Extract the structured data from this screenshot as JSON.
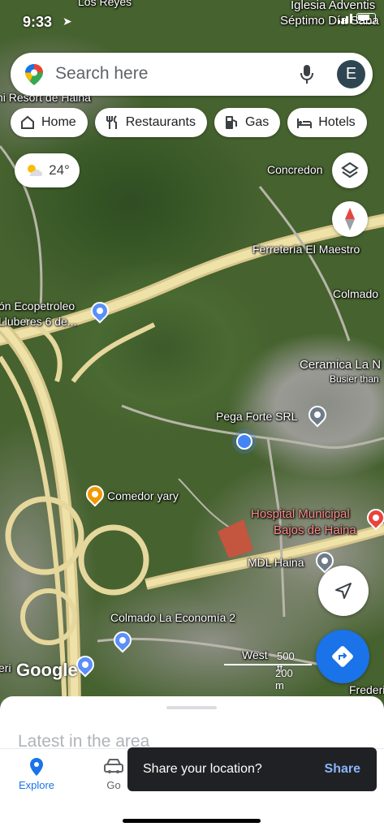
{
  "status_bar": {
    "time": "9:33"
  },
  "search": {
    "placeholder": "Search here",
    "avatar_letter": "E"
  },
  "chips": [
    {
      "label": "Home",
      "icon": "home-icon"
    },
    {
      "label": "Restaurants",
      "icon": "restaurant-icon"
    },
    {
      "label": "Gas",
      "icon": "gas-station-icon"
    },
    {
      "label": "Hotels",
      "icon": "hotel-icon"
    }
  ],
  "weather": {
    "temp": "24°",
    "icon": "partly-cloudy-icon"
  },
  "map_labels": {
    "top_right_1": "Iglesia Adventis",
    "top_right_2": "Séptimo Día Saba",
    "top_left": "Los Reyes",
    "resort": "ni Resort de Haina",
    "concredon": "Concredon",
    "ferreteria": "Ferretería El Maestro",
    "colmado_right": "Colmado",
    "ecopetroleo_1": "ón Ecopetroleo",
    "ecopetroleo_2": "Lluberes 6 de...",
    "ceramica": "Ceramica La N",
    "busier": "Busier than",
    "pega_forte": "Pega Forte SRL",
    "comedor": "Comedor yary",
    "hospital_1": "Hospital Municipal",
    "hospital_2": "Bajos de Haina",
    "mdl": "MDL Haina",
    "colmado_economia": "Colmado La Economía 2",
    "west": "West",
    "left_edge": "eri",
    "right_edge": "Frederic"
  },
  "scale": {
    "imperial": "500 ft",
    "metric": "200 m"
  },
  "google_logo": "Google",
  "sheet": {
    "latest": "Latest in the area"
  },
  "tabs": [
    {
      "label": "Explore",
      "icon": "location-pin-icon"
    },
    {
      "label": "Go",
      "icon": "car-icon"
    }
  ],
  "snackbar": {
    "message": "Share your location?",
    "action": "Share"
  },
  "colors": {
    "accent": "#1a73e8",
    "avatar": "#2f4652",
    "snackbar_bg": "#202124",
    "snackbar_action": "#8ab4f8"
  }
}
